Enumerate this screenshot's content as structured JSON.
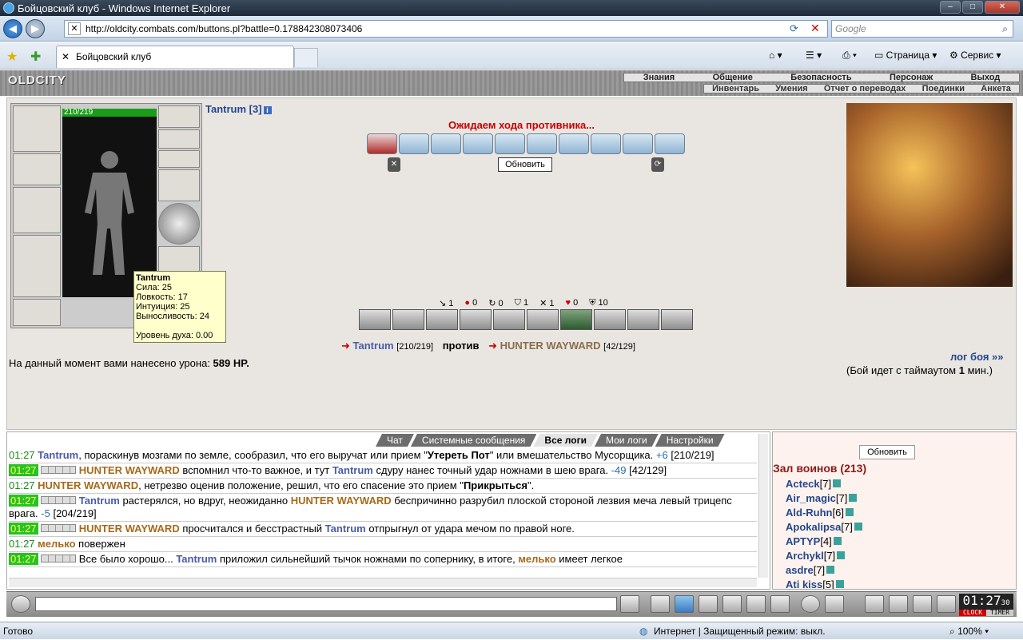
{
  "window": {
    "title": "Бойцовский клуб - Windows Internet Explorer"
  },
  "browser": {
    "url": "http://oldcity.combats.com/buttons.pl?battle=0.178842308073406",
    "search_placeholder": "Google",
    "tab_title": "Бойцовский клуб",
    "tools": {
      "page": "Страница",
      "service": "Сервис"
    }
  },
  "game_menu": {
    "logo": "OLDCITY",
    "row1": [
      "Знания",
      "Общение",
      "Безопасность",
      "Персонаж",
      "Выход"
    ],
    "row2": [
      "Инвентарь",
      "Умения",
      "Отчет о переводах",
      "Поединки",
      "Анкета"
    ]
  },
  "character": {
    "hp": "210/219",
    "name": "Tantrum [3]",
    "info_icon": "i"
  },
  "tooltip": {
    "name": "Tantrum",
    "strength": "Сила: 25",
    "agility": "Ловкость: 17",
    "intuition": "Интуиция: 25",
    "endurance": "Выносливость: 24",
    "spirit": "Уровень духа: 0.00"
  },
  "battle": {
    "waiting": "Ожидаем хода противника...",
    "refresh": "Обновить",
    "stats": [
      "1",
      "0",
      "0",
      "1",
      "1",
      "0",
      "10"
    ],
    "player1": "Tantrum",
    "player1_hp": "[210/219]",
    "versus": "против",
    "player2": "HUNTER WAYWARD",
    "player2_hp": "[42/129]",
    "damage_label": "На данный момент вами нанесено урона:",
    "damage_value": "589 HP.",
    "log_link": "лог боя »»",
    "timeout_prefix": "(Бой идет с таймаутом",
    "timeout_value": "1",
    "timeout_suffix": "мин.)"
  },
  "chat": {
    "tabs": [
      "Чат",
      "Системные сообщения",
      "Все логи",
      "Мои логи",
      "Настройки"
    ],
    "selected_tab": "Все логи",
    "lines": [
      {
        "time": "01:27",
        "hl": false,
        "a": "Tantrum",
        "t1": ", пораскинув мозгами по земле, сообразил, что его выручат или прием \"",
        "b": "Утереть Пот",
        "t2": "\" или вмешательство Мусорщика. ",
        "d": "+6",
        "t3": " [210/219]"
      },
      {
        "time": "01:27",
        "hl": true,
        "a": "HUNTER WAYWARD",
        "t1": " вспомнил что-то важное, и тут ",
        "c": "Tantrum",
        "t2": " сдуру нанес точный удар ножнами в шею врага. ",
        "d": "-49",
        "t3": " [42/129]"
      },
      {
        "time": "01:27",
        "hl": false,
        "a": "HUNTER WAYWARD",
        "t1": ", нетрезво оценив положение, решил, что его спасение это прием \"",
        "b": "Прикрыться",
        "t2": "\".",
        "d": "",
        "t3": ""
      },
      {
        "time": "01:27",
        "hl": true,
        "a": "Tantrum",
        "t1": " растерялся, но вдруг, неожиданно ",
        "c": "HUNTER WAYWARD",
        "t2": " беспричинно разрубил плоской стороной лезвия меча левый трицепс врага. ",
        "d": "-5",
        "t3": " [204/219]"
      },
      {
        "time": "01:27",
        "hl": true,
        "a": "HUNTER WAYWARD",
        "t1": " просчитался и бесстрастный ",
        "c": "Tantrum",
        "t2": " отпрыгнул от удара мечом по правой ноге.",
        "d": "",
        "t3": ""
      },
      {
        "time": "01:27",
        "hl": false,
        "a": "мелько",
        "t1": " повержен",
        "d": "",
        "t3": ""
      },
      {
        "time": "01:27",
        "hl": true,
        "a": "",
        "t1": "Все было хорошо... ",
        "c": "Tantrum",
        "t2": " приложил сильнейший тычок ножнами по сопернику, в итоге, ",
        "e": "мелько",
        "t3": " имеет легкое"
      }
    ]
  },
  "users": {
    "refresh": "Обновить",
    "heading": "Зал воинов (213)",
    "list": [
      {
        "name": "Acteck",
        "lvl": "[7]"
      },
      {
        "name": "Air_magic",
        "lvl": "[7]"
      },
      {
        "name": "Ald-Ruhn",
        "lvl": "[6]"
      },
      {
        "name": "Apokalipsa",
        "lvl": "[7]"
      },
      {
        "name": "APTYP",
        "lvl": "[4]"
      },
      {
        "name": "Archykl",
        "lvl": "[7]"
      },
      {
        "name": "asdre",
        "lvl": "[7]"
      },
      {
        "name": "Ati kiss",
        "lvl": "[5]"
      }
    ]
  },
  "clock": {
    "time": "01:27",
    "seconds": "30",
    "clock_label": "CLOCK",
    "timer_label": "TIMER"
  },
  "statusbar": {
    "left": "Готово",
    "zone": "Интернет | Защищенный режим: выкл.",
    "zoom": "100%"
  }
}
